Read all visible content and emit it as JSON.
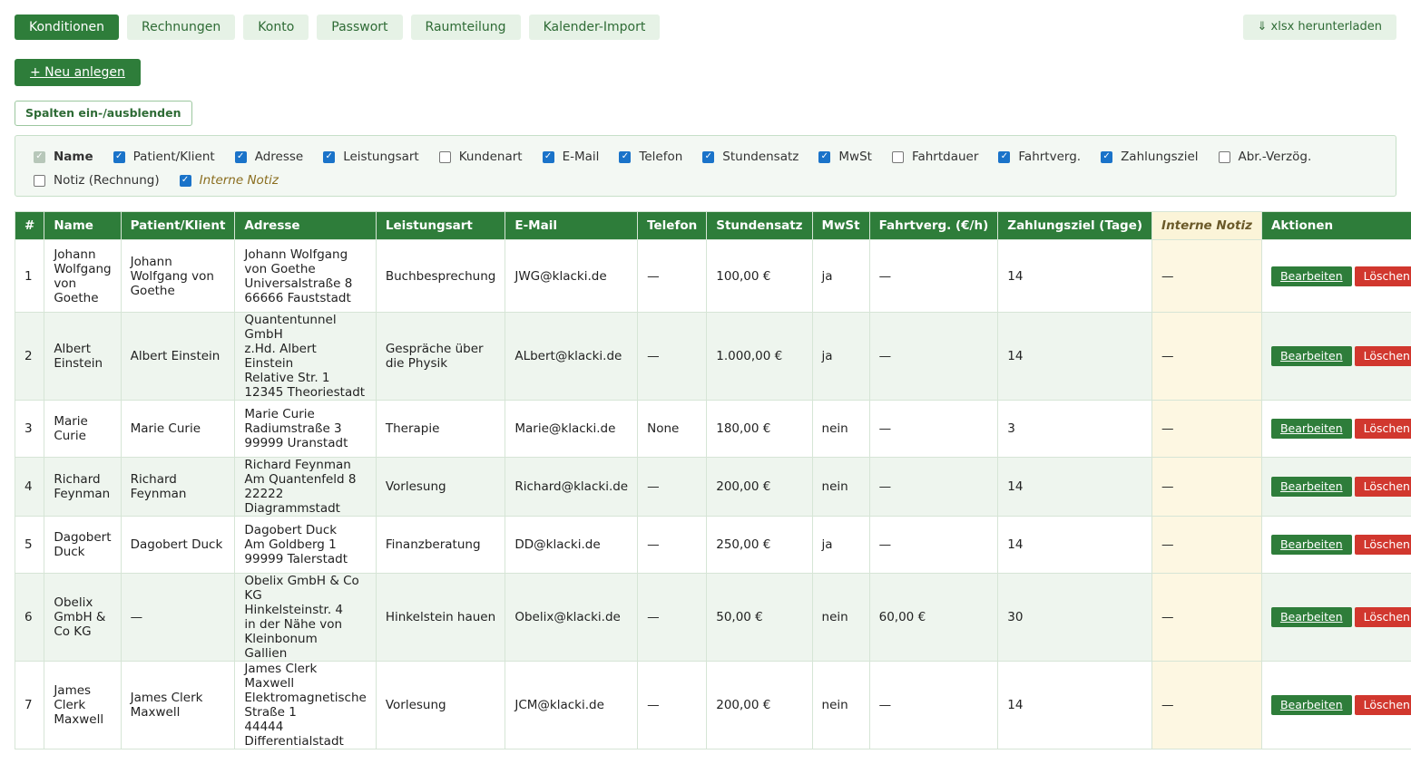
{
  "tabs": [
    {
      "label": "Konditionen",
      "active": true
    },
    {
      "label": "Rechnungen",
      "active": false
    },
    {
      "label": "Konto",
      "active": false
    },
    {
      "label": "Passwort",
      "active": false
    },
    {
      "label": "Raumteilung",
      "active": false
    },
    {
      "label": "Kalender-Import",
      "active": false
    }
  ],
  "xlsx_label": "⇓ xlsx herunterladen",
  "new_label": "+ Neu anlegen",
  "columns_toggle_label": "Spalten ein-/ausblenden",
  "column_options_row1": [
    {
      "label": "Name",
      "state": "disabled"
    },
    {
      "label": "Patient/Klient",
      "state": "on"
    },
    {
      "label": "Adresse",
      "state": "on"
    },
    {
      "label": "Leistungsart",
      "state": "on"
    },
    {
      "label": "Kundenart",
      "state": "off"
    },
    {
      "label": "E-Mail",
      "state": "on"
    },
    {
      "label": "Telefon",
      "state": "on"
    },
    {
      "label": "Stundensatz",
      "state": "on"
    },
    {
      "label": "MwSt",
      "state": "on"
    },
    {
      "label": "Fahrtdauer",
      "state": "off"
    },
    {
      "label": "Fahrtverg.",
      "state": "on"
    },
    {
      "label": "Zahlungsziel",
      "state": "on"
    },
    {
      "label": "Abr.-Verzög.",
      "state": "off"
    }
  ],
  "column_options_row2": [
    {
      "label": "Notiz (Rechnung)",
      "state": "off"
    },
    {
      "label": "Interne Notiz",
      "state": "on"
    }
  ],
  "table": {
    "headers": [
      "#",
      "Name",
      "Patient/Klient",
      "Adresse",
      "Leistungsart",
      "E-Mail",
      "Telefon",
      "Stundensatz",
      "MwSt",
      "Fahrtverg. (€/h)",
      "Zahlungsziel (Tage)",
      "Interne Notiz",
      "Aktionen"
    ],
    "edit_label": "Bearbeiten",
    "delete_label": "Löschen",
    "rows": [
      {
        "nr": "1",
        "name": "Johann Wolfgang von Goethe",
        "client": "Johann Wolfgang von Goethe",
        "address": [
          "Johann Wolfgang von Goethe",
          "Universalstraße 8",
          "66666 Fauststadt"
        ],
        "service": "Buchbesprechung",
        "email": "JWG@klacki.de",
        "phone": "—",
        "rate": "100,00 €",
        "vat": "ja",
        "travel": "—",
        "payment": "14",
        "note": "—"
      },
      {
        "nr": "2",
        "name": "Albert Einstein",
        "client": "Albert Einstein",
        "address": [
          "Quantentunnel GmbH",
          "z.Hd. Albert Einstein",
          "Relative Str. 1",
          "12345 Theoriestadt"
        ],
        "service": "Gespräche über die Physik",
        "email": "ALbert@klacki.de",
        "phone": "—",
        "rate": "1.000,00 €",
        "vat": "ja",
        "travel": "—",
        "payment": "14",
        "note": "—"
      },
      {
        "nr": "3",
        "name": "Marie Curie",
        "client": "Marie Curie",
        "address": [
          "Marie Curie",
          "Radiumstraße 3",
          "99999 Uranstadt"
        ],
        "service": "Therapie",
        "email": "Marie@klacki.de",
        "phone": "None",
        "rate": "180,00 €",
        "vat": "nein",
        "travel": "—",
        "payment": "3",
        "note": "—"
      },
      {
        "nr": "4",
        "name": "Richard Feynman",
        "client": "Richard Feynman",
        "address": [
          "Richard Feynman",
          "Am Quantenfeld 8",
          "22222 Diagrammstadt"
        ],
        "service": "Vorlesung",
        "email": "Richard@klacki.de",
        "phone": "—",
        "rate": "200,00 €",
        "vat": "nein",
        "travel": "—",
        "payment": "14",
        "note": "—"
      },
      {
        "nr": "5",
        "name": "Dagobert Duck",
        "client": "Dagobert Duck",
        "address": [
          "Dagobert Duck",
          "Am Goldberg 1",
          "99999 Talerstadt"
        ],
        "service": "Finanzberatung",
        "email": "DD@klacki.de",
        "phone": "—",
        "rate": "250,00 €",
        "vat": "ja",
        "travel": "—",
        "payment": "14",
        "note": "—"
      },
      {
        "nr": "6",
        "name": "Obelix GmbH & Co KG",
        "client": "—",
        "address": [
          "Obelix GmbH & Co KG",
          "Hinkelsteinstr. 4",
          "in der Nähe von",
          "Kleinbonum",
          "Gallien"
        ],
        "service": "Hinkelstein hauen",
        "email": "Obelix@klacki.de",
        "phone": "—",
        "rate": "50,00 €",
        "vat": "nein",
        "travel": "60,00 €",
        "payment": "30",
        "note": "—"
      },
      {
        "nr": "7",
        "name": "James Clerk Maxwell",
        "client": "James Clerk Maxwell",
        "address": [
          "James Clerk Maxwell",
          "Elektromagnetische",
          "Straße 1",
          "44444",
          "Differentialstadt"
        ],
        "service": "Vorlesung",
        "email": "JCM@klacki.de",
        "phone": "—",
        "rate": "200,00 €",
        "vat": "nein",
        "travel": "—",
        "payment": "14",
        "note": "—"
      }
    ]
  }
}
